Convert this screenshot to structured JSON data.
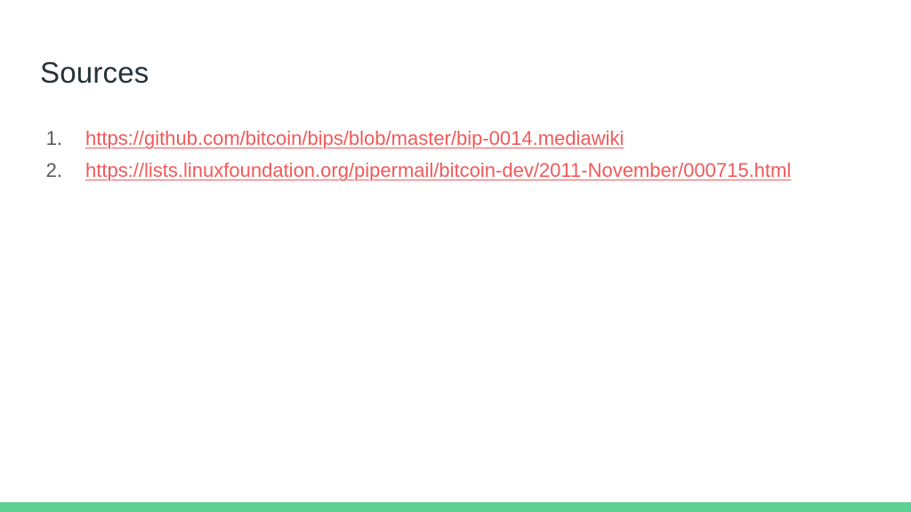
{
  "slide": {
    "title": "Sources",
    "sources": [
      {
        "number": "1.",
        "url": "https://github.com/bitcoin/bips/blob/master/bip-0014.mediawiki"
      },
      {
        "number": "2.",
        "url": "https://lists.linuxfoundation.org/pipermail/bitcoin-dev/2011-November/000715.html"
      }
    ]
  },
  "colors": {
    "link": "#f05a5a",
    "title": "#263238",
    "list_number": "#595959",
    "accent_bar": "#5fcf94",
    "background": "#ffffff"
  }
}
